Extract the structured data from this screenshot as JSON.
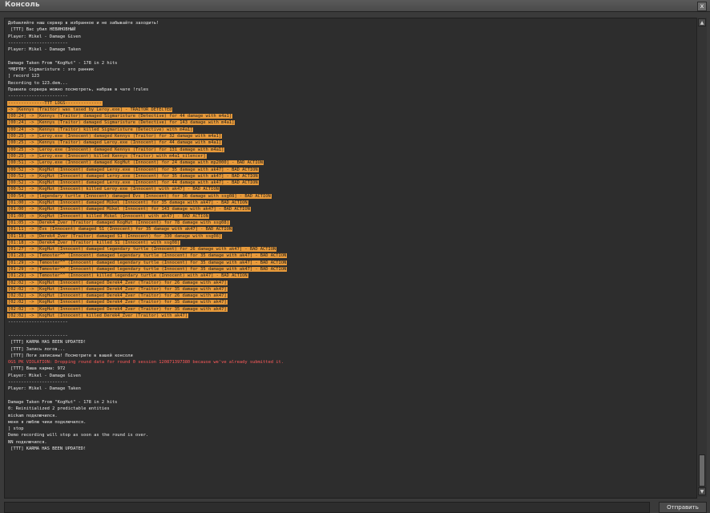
{
  "window": {
    "title": "Консоль",
    "close_label": "x"
  },
  "console": {
    "lines": [
      {
        "text": "Добавляйте наш сервер в избранное и не забывайте заходить!",
        "style": "normal"
      },
      {
        "text": " [TTT] Вас убил НЕВИНОВНЫЙ",
        "style": "normal"
      },
      {
        "text": "Player: Mikel - Damage Given",
        "style": "normal"
      },
      {
        "text": "-----------------------",
        "style": "normal"
      },
      {
        "text": "Player: Mikel - Damage Taken",
        "style": "normal"
      },
      {
        "text": "",
        "style": "normal"
      },
      {
        "text": "Damage Taken From \"KogHut\" - 178 in 2 hits",
        "style": "normal"
      },
      {
        "text": "*MEPTB* Sigmaristure : это ранник",
        "style": "normal"
      },
      {
        "text": "] record 123",
        "style": "normal"
      },
      {
        "text": "Recording to 123.dem...",
        "style": "normal"
      },
      {
        "text": "Правила сервера можно посмотреть, набрав в чате !rules",
        "style": "normal"
      },
      {
        "text": "-----------------------",
        "style": "normal"
      },
      {
        "text": "--------------TTT LOGS--------------",
        "style": "hl"
      },
      {
        "text": "-> [Kennys (Traitor) was tased by Leroy.exe] - TRAITOR DETECTED",
        "style": "hl"
      },
      {
        "text": "[00:24] -> [Kennys (Traitor) damaged Sigmaristure (Detective) for 44 damage with m4a1]",
        "style": "hl"
      },
      {
        "text": "[00:24] -> [Kennys (Traitor) damaged Sigmaristure (Detective) for 143 damage with m4a1]",
        "style": "hl"
      },
      {
        "text": "[00:24] -> [Kennys (Traitor) killed Sigmaristure (Detective) with m4a1]",
        "style": "hl"
      },
      {
        "text": "[00:25] -> [Leroy.exe (Innocent) damaged Kennys (Traitor) for 32 damage with m4a1]",
        "style": "hl"
      },
      {
        "text": "[00:25] -> [Kennys (Traitor) damaged Leroy.exe (Innocent) for 44 damage with m4a1]",
        "style": "hl"
      },
      {
        "text": "[00:25] -> [Leroy.exe (Innocent) damaged Kennys (Traitor) for 131 damage with m4a1]",
        "style": "hl"
      },
      {
        "text": "[00:25] -> [Leroy.exe (Innocent) killed Kennys (Traitor) with m4a1_silencer]",
        "style": "hl"
      },
      {
        "text": "[00:51] -> [Leroy.exe (Innocent) damaged KogHut (Innocent) for 24 damage with mp2000] - BAD ACTION",
        "style": "hl"
      },
      {
        "text": "[00:52] -> [KogHut (Innocent) damaged Leroy.exe (Innocent) for 35 damage with ak47] - BAD ACTION",
        "style": "hl"
      },
      {
        "text": "[00:52] -> [KogHut (Innocent) damaged Leroy.exe (Innocent) for 35 damage with ak47] - BAD ACTION",
        "style": "hl"
      },
      {
        "text": "[00:52] -> [KogHut (Innocent) damaged Leroy.exe (Innocent) for 44 damage with ak47] - BAD ACTION",
        "style": "hl"
      },
      {
        "text": "[00:52] -> [KogHut (Innocent) killed Leroy.exe (Innocent) with ak47] - BAD ACTION",
        "style": "hl"
      },
      {
        "text": "[00:54] -> [legendary turtle (Innocent) damaged Evs (Innocent) for 36 damage with ssg08] - BAD ACTION",
        "style": "hl"
      },
      {
        "text": "[01:00] -> [KogHut (Innocent) damaged Mikel (Innocent) for 35 damage with ak47] - BAD ACTION",
        "style": "hl"
      },
      {
        "text": "[01:00] -> [KogHut (Innocent) damaged Mikel (Innocent) for 143 damage with ak47] - BAD ACTION",
        "style": "hl"
      },
      {
        "text": "[01:00] -> [KogHut (Innocent) killed Mikel (Innocent) with ak47] - BAD ACTION",
        "style": "hl"
      },
      {
        "text": "[01:05] -> [Derek4_Zver (Traitor) damaged KogHut (Innocent) for 78 damage with ssg08]",
        "style": "hl"
      },
      {
        "text": "[01:11] -> [Evs (Innocent) damaged S1 (Innocent) for 35 damage with ak47] - BAD ACTION",
        "style": "hl"
      },
      {
        "text": "[01:18] -> [Derek4_Zver (Traitor) damaged S1 (Innocent) for 330 damage with ssg08]",
        "style": "hl"
      },
      {
        "text": "[01:18] -> [Derek4_Zver (Traitor) killed S1 (Innocent) with ssg08]",
        "style": "hl"
      },
      {
        "text": "[01:27] -> [KogHut (Innocent) damaged legendary turtle (Innocent) for 26 damage with ak47] - BAD ACTION",
        "style": "hl"
      },
      {
        "text": "[01:28] -> [Temoster^^ (Innocent) damaged legendary turtle (Innocent) for 35 damage with ak47] - BAD ACTION",
        "style": "hl"
      },
      {
        "text": "[01:29] -> [Temoster^^ (Innocent) damaged legendary turtle (Innocent) for 35 damage with ak47] - BAD ACTION",
        "style": "hl"
      },
      {
        "text": "[01:29] -> [Temoster^^ (Innocent) damaged legendary turtle (Innocent) for 35 damage with ak47] - BAD ACTION",
        "style": "hl"
      },
      {
        "text": "[01:29] -> [Temoster^^ (Innocent) killed legendary turtle (Innocent) with ak47] - BAD ACTION",
        "style": "hl"
      },
      {
        "text": "[02:02] -> [KogHut (Innocent) damaged Derek4_Zver (Traitor) for 26 damage with ak47]",
        "style": "hl"
      },
      {
        "text": "[02:02] -> [KogHut (Innocent) damaged Derek4_Zver (Traitor) for 35 damage with ak47]",
        "style": "hl"
      },
      {
        "text": "[02:02] -> [KogHut (Innocent) damaged Derek4_Zver (Traitor) for 26 damage with ak47]",
        "style": "hl"
      },
      {
        "text": "[02:02] -> [KogHut (Innocent) damaged Derek4_Zver (Traitor) for 35 damage with ak47]",
        "style": "hl"
      },
      {
        "text": "[02:02] -> [KogHut (Innocent) damaged Derek4_Zver (Traitor) for 35 damage with ak47]",
        "style": "hl"
      },
      {
        "text": "[02:02] -> [KogHut (Innocent) killed Derek4_Zver (Traitor) with ak47]",
        "style": "hl"
      },
      {
        "text": "-----------------------",
        "style": "normal"
      },
      {
        "text": "",
        "style": "normal"
      },
      {
        "text": "-----------------------",
        "style": "normal"
      },
      {
        "text": " [TTT] KARMA HAS BEEN UPDATED!",
        "style": "normal"
      },
      {
        "text": " [TTT] Запись логов...",
        "style": "normal"
      },
      {
        "text": " [TTT] Логи записаны! Посмотрите в вашей консоли",
        "style": "normal"
      },
      {
        "text": "OGS PK VIOLATION: Dropping round data for round 0 session 120871397380 because we've already submitted it.",
        "style": "red"
      },
      {
        "text": " [TTT] Ваша карма: 972",
        "style": "normal"
      },
      {
        "text": "Player: Mikel - Damage Given",
        "style": "normal"
      },
      {
        "text": "-----------------------",
        "style": "normal"
      },
      {
        "text": "Player: Mikel - Damage Taken",
        "style": "normal"
      },
      {
        "text": "",
        "style": "normal"
      },
      {
        "text": "Damage Taken From \"KogHut\" - 178 in 2 hits",
        "style": "normal"
      },
      {
        "text": "0: Reinitialized 2 predictable entities",
        "style": "normal"
      },
      {
        "text": "mickam подключился.",
        "style": "normal"
      },
      {
        "text": "меня я люблю чики подключился.",
        "style": "normal"
      },
      {
        "text": "] stop",
        "style": "normal"
      },
      {
        "text": "Demo recording will stop as soon as the round is over.",
        "style": "normal"
      },
      {
        "text": "NN подключился.",
        "style": "normal"
      },
      {
        "text": " [TTT] KARMA HAS BEEN UPDATED!",
        "style": "normal"
      }
    ]
  },
  "input": {
    "value": ""
  },
  "send_button": {
    "label": "Отправить"
  }
}
